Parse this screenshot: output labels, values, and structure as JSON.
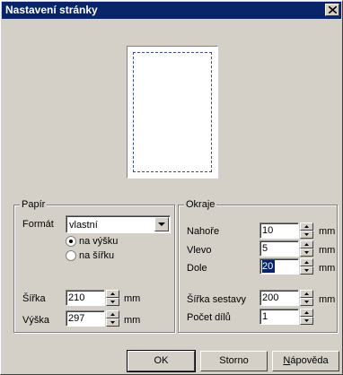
{
  "window": {
    "title": "Nastavení stránky"
  },
  "paper": {
    "group_label": "Papír",
    "format_label": "Formát",
    "format_value": "vlastní",
    "orientation": [
      {
        "label": "na výšku",
        "selected": true
      },
      {
        "label": "na šířku",
        "selected": false
      }
    ],
    "width_label": "Šířka",
    "width_value": "210",
    "height_label": "Výška",
    "height_value": "297",
    "unit": "mm"
  },
  "margins": {
    "group_label": "Okraje",
    "top_label": "Nahoře",
    "top_value": "10",
    "left_label": "Vlevo",
    "left_value": "5",
    "bottom_label": "Dole",
    "bottom_value": "20",
    "assembly_width_label": "Šířka sestavy",
    "assembly_width_value": "200",
    "parts_label": "Počet dílů",
    "parts_value": "1",
    "unit": "mm"
  },
  "buttons": {
    "ok": "OK",
    "cancel": "Storno",
    "help_first": "N",
    "help_rest": "ápověda"
  }
}
